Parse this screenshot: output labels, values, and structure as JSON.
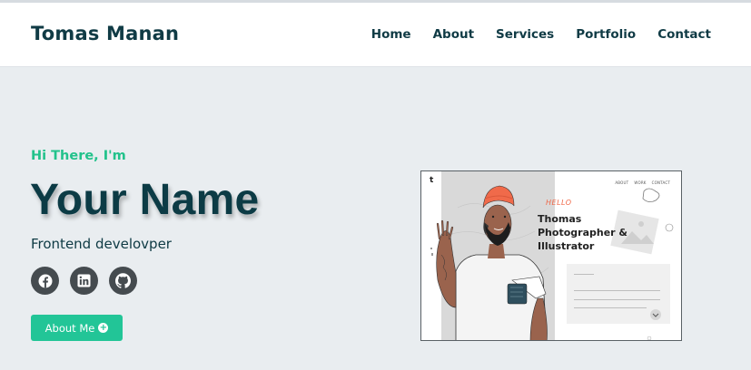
{
  "brand": "Tomas Manan",
  "nav": {
    "home": "Home",
    "about": "About",
    "services": "Services",
    "portfolio": "Portfolio",
    "contact": "Contact"
  },
  "hero": {
    "greeting": "Hi There, I'm",
    "name": "Your Name",
    "role": "Frontend develovper",
    "about_button": "About Me",
    "socials": [
      "facebook-icon",
      "linkedin-icon",
      "github-icon"
    ]
  },
  "mockup": {
    "logo": "t",
    "nav_items": [
      "ABOUT",
      "WORK",
      "CONTACT"
    ],
    "hello": "HELLO",
    "title": "Thomas Photographer & Illustrator"
  },
  "colors": {
    "accent": "#22c597",
    "heading": "#0c3b45",
    "background": "#e9edf0",
    "icon_bg": "#454b4f"
  }
}
